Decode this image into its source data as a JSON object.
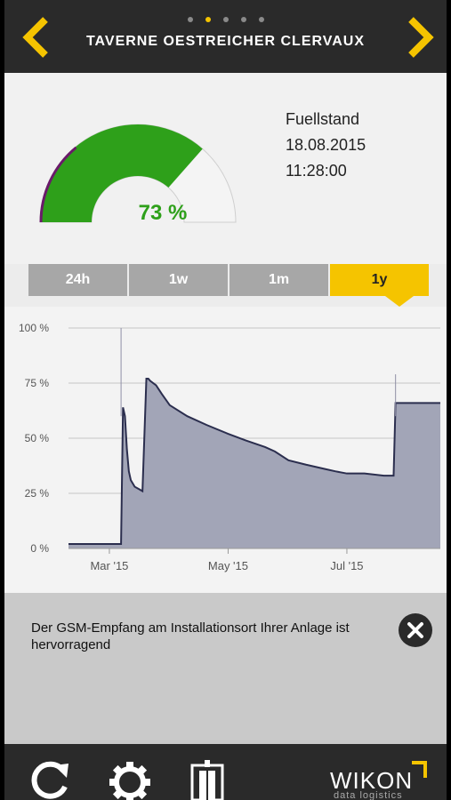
{
  "header": {
    "title": "TAVERNE OESTREICHER CLERVAUX",
    "page_count": 5,
    "active_page": 2,
    "prev_icon": "chevron-left-icon",
    "next_icon": "chevron-right-icon"
  },
  "gauge": {
    "percent_label": "73 %",
    "fill_fraction": 0.73,
    "label": "Fuellstand",
    "date": "18.08.2015",
    "time": "11:28:00"
  },
  "tabs": [
    {
      "label": "24h",
      "active": false
    },
    {
      "label": "1w",
      "active": false
    },
    {
      "label": "1m",
      "active": false
    },
    {
      "label": "1y",
      "active": true
    }
  ],
  "chart_data": {
    "type": "area",
    "y_tick_labels": [
      "100 %",
      "75 %",
      "50 %",
      "25 %",
      "0 %"
    ],
    "x_tick_labels": [
      "Mar '15",
      "May '15",
      "Jul '15"
    ],
    "ylim": [
      0,
      100
    ],
    "xlim": [
      "2015-02-08",
      "2015-08-18"
    ],
    "x_ticks": [
      "2015-03-01",
      "2015-05-01",
      "2015-07-01"
    ],
    "series": [
      {
        "x": [
          "2015-02-08",
          "2015-02-25",
          "2015-03-07",
          "2015-03-08",
          "2015-03-09",
          "2015-03-10",
          "2015-03-11",
          "2015-03-12",
          "2015-03-14",
          "2015-03-16",
          "2015-03-18",
          "2015-03-20",
          "2015-03-21",
          "2015-03-22",
          "2015-03-25",
          "2015-03-28",
          "2015-04-01",
          "2015-04-10",
          "2015-04-20",
          "2015-05-01",
          "2015-05-10",
          "2015-05-20",
          "2015-05-25",
          "2015-06-01",
          "2015-06-10",
          "2015-06-20",
          "2015-06-25",
          "2015-07-01",
          "2015-07-10",
          "2015-07-20",
          "2015-07-25",
          "2015-07-26",
          "2015-08-18"
        ],
        "y": [
          2,
          2,
          2,
          64,
          60,
          45,
          35,
          31,
          28,
          27,
          26,
          77,
          77,
          76,
          74,
          70,
          65,
          60,
          56,
          52,
          49,
          46,
          44,
          40,
          38,
          36,
          35,
          34,
          34,
          33,
          33,
          66,
          66
        ]
      }
    ],
    "spikes": [
      {
        "x": "2015-03-07",
        "y": 100
      },
      {
        "x": "2015-07-26",
        "y": 79
      }
    ],
    "fill_color": "#a2a5b7",
    "line_color": "#2b2e4e"
  },
  "message": {
    "text": "Der GSM-Empfang am Installationsort Ihrer Anlage ist hervorragend",
    "close_icon": "close-circle-icon"
  },
  "footer": {
    "refresh_icon": "refresh-icon",
    "settings_icon": "gear-icon",
    "door_icon": "door-icon",
    "logo_text": "WIKON",
    "logo_subtext": "data logistics"
  },
  "colors": {
    "accent": "#f5c400",
    "gauge_fill": "#2ea01a",
    "gauge_edge": "#6a1a6a",
    "tab_inactive": "#a7a7a7"
  }
}
